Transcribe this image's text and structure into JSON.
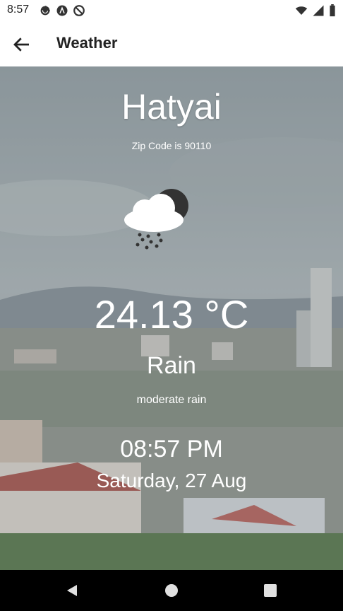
{
  "status": {
    "time": "8:57",
    "left_icons": [
      "gear-icon",
      "a-circle-icon",
      "no-disturb-icon"
    ],
    "right_icons": [
      "wifi-icon",
      "signal-icon",
      "battery-icon"
    ]
  },
  "appbar": {
    "title": "Weather",
    "back_icon": "arrow-back-icon"
  },
  "weather": {
    "city": "Hatyai",
    "zip_text": "Zip Code is 90110",
    "icon": "cloud-rain-moon-icon",
    "temperature": "24.13 °C",
    "condition": "Rain",
    "description": "moderate rain",
    "time": "08:57 PM",
    "date": "Saturday, 27 Aug"
  },
  "navbar": {
    "buttons": [
      "back-triangle-icon",
      "home-circle-icon",
      "recents-square-icon"
    ]
  }
}
